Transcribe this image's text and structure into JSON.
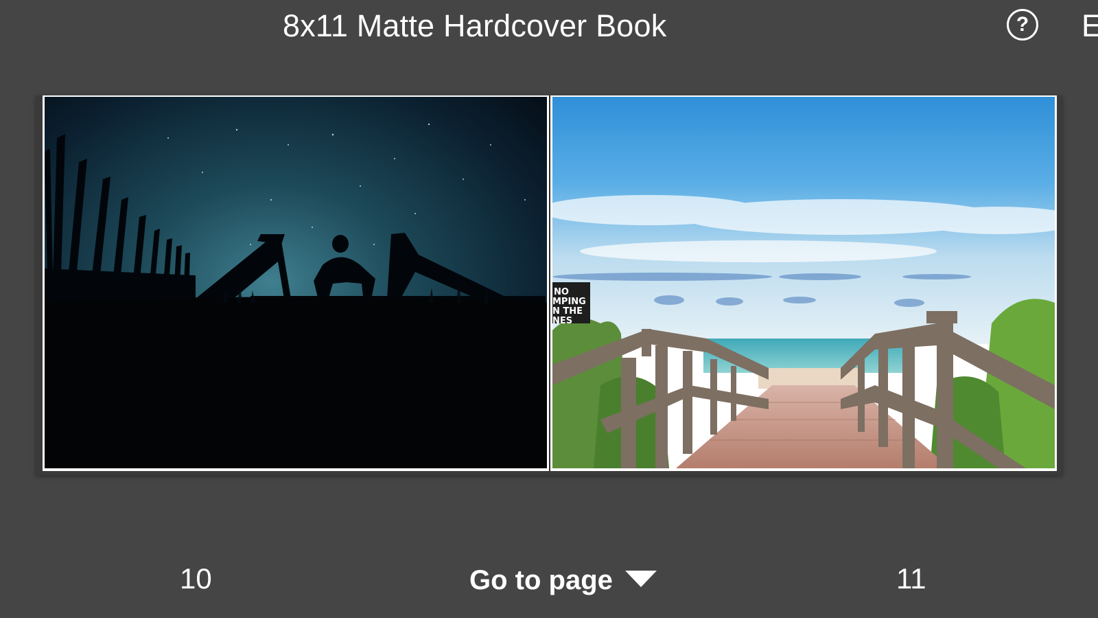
{
  "header": {
    "title": "8x11 Matte Hardcover Book",
    "help_label": "?",
    "edge_label": "E",
    "help_icon": "question-circle-icon"
  },
  "spread": {
    "left_page": {
      "number": "10",
      "photo": "night-silhouette-boardwalk-photo"
    },
    "right_page": {
      "number": "11",
      "photo": "beach-boardwalk-photo",
      "sign_text": [
        "NO",
        "MPING",
        "N THE",
        "NES"
      ]
    }
  },
  "navigation": {
    "goto_label": "Go to page",
    "goto_icon": "caret-down-icon"
  },
  "colors": {
    "background": "#454545",
    "text": "#ffffff",
    "page_border": "#ffffff"
  }
}
